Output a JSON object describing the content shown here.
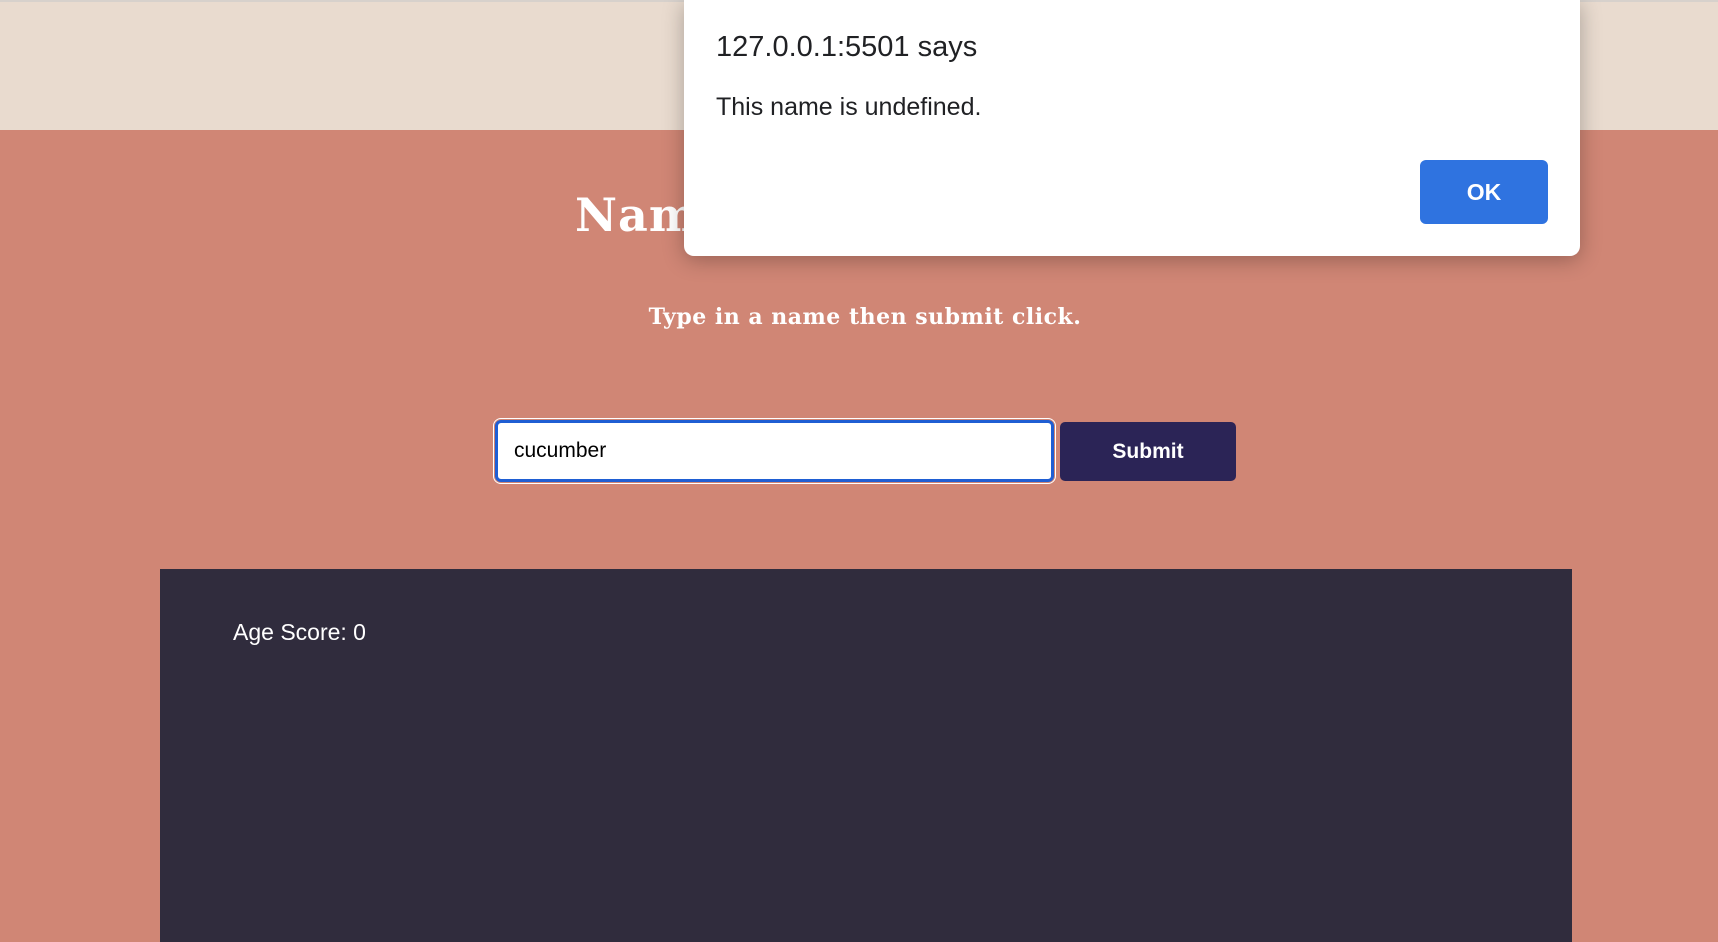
{
  "page": {
    "heading": "Name",
    "subtitle": "Type in a name then submit click."
  },
  "form": {
    "input_value": "cucumber",
    "submit_label": "Submit"
  },
  "result": {
    "score_text": "Age Score: 0"
  },
  "dialog": {
    "title": "127.0.0.1:5501 says",
    "message": "This name is undefined.",
    "ok_label": "OK"
  },
  "colors": {
    "top_band": "#e9dbcf",
    "page_background": "#d08675",
    "submit_button": "#2b2456",
    "result_panel": "#302c3d",
    "dialog_ok_button": "#2f73e0",
    "input_focus_border": "#1f5ed3"
  }
}
